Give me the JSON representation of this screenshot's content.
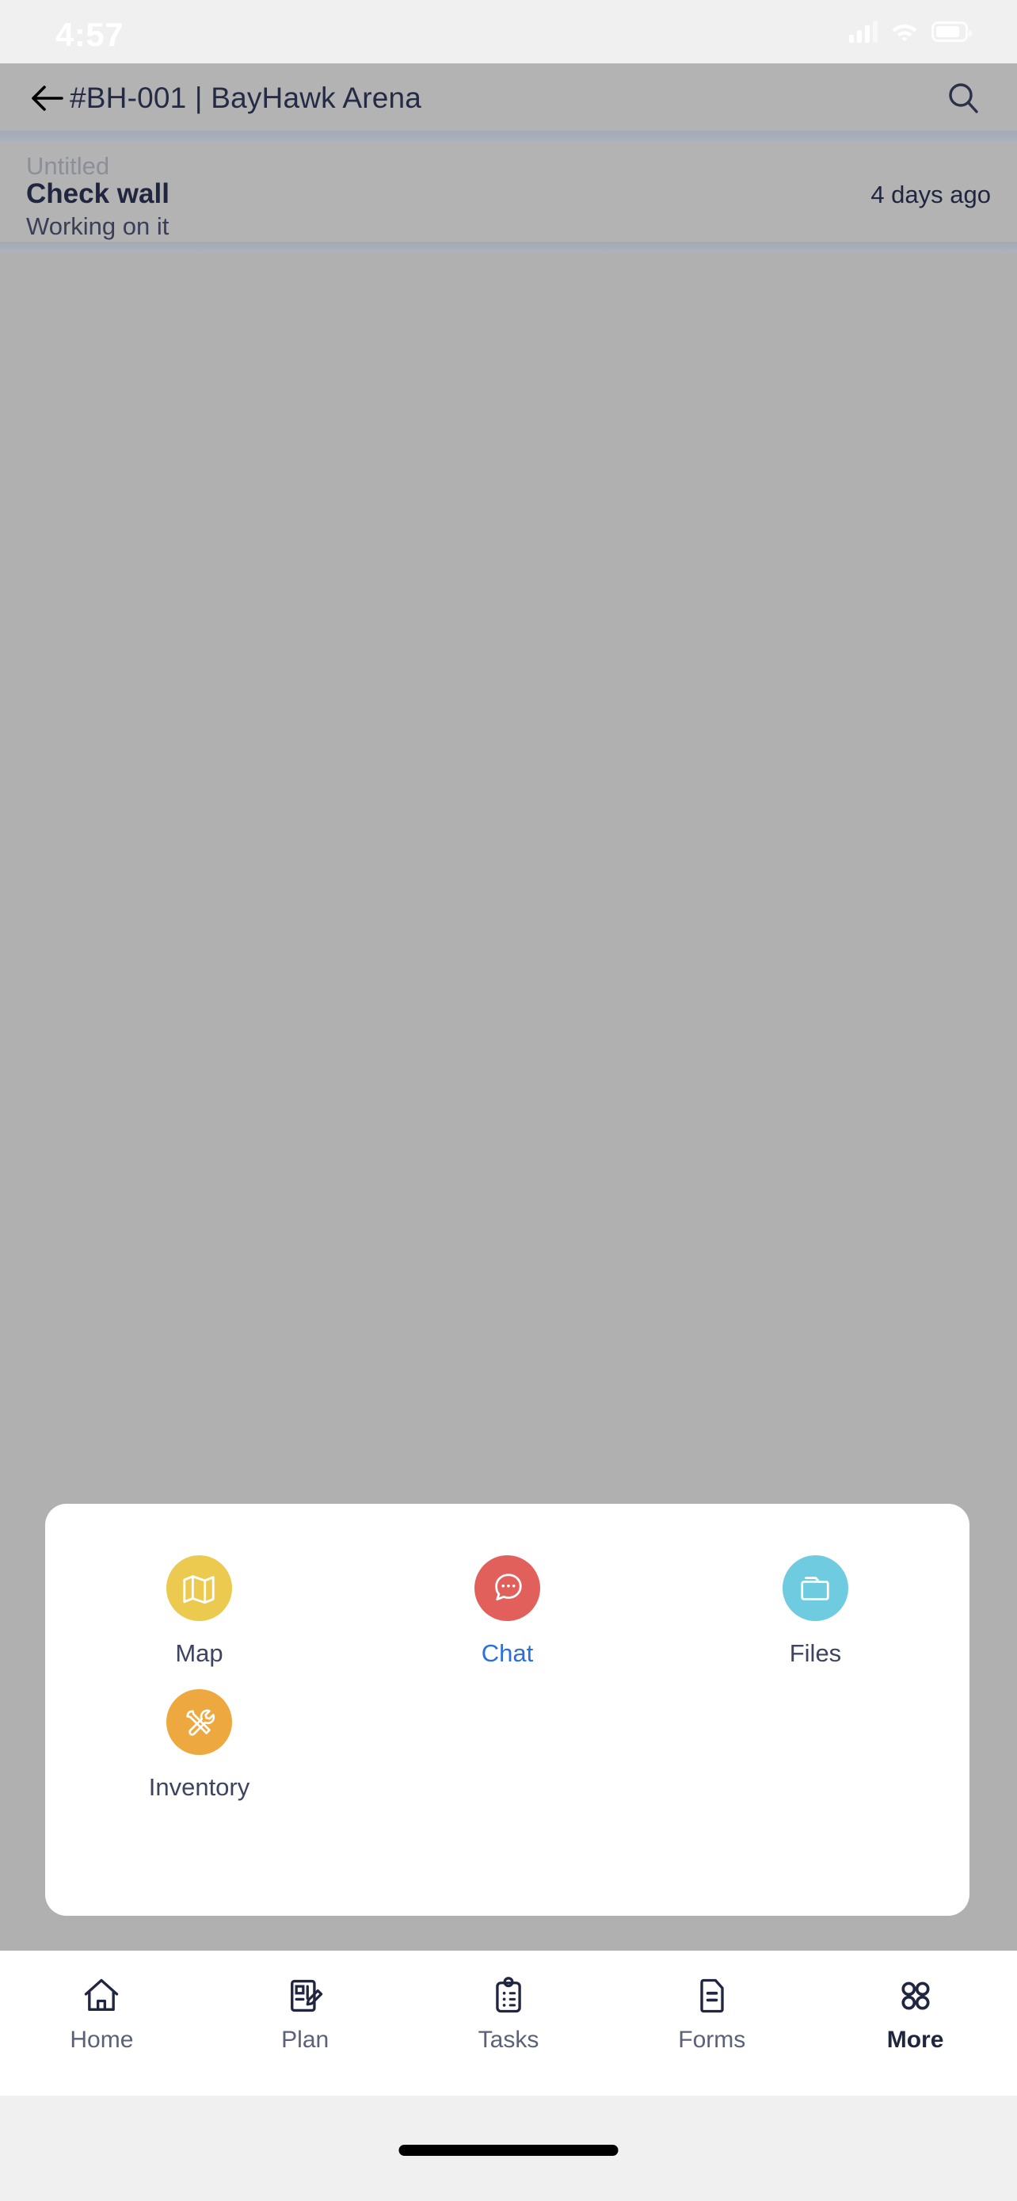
{
  "status_bar": {
    "time": "4:57",
    "cellular_icon": "signal-bars-icon",
    "wifi_icon": "wifi-icon",
    "battery_icon": "battery-icon"
  },
  "header": {
    "back_icon": "back-arrow-icon",
    "title": "#BH-001 | BayHawk Arena",
    "search_icon": "search-icon"
  },
  "task_card": {
    "subtitle": "Untitled",
    "title": "Check wall",
    "status": "Working on it",
    "timestamp": "4 days ago"
  },
  "more_sheet": {
    "items": [
      {
        "label": "Map",
        "icon": "map-icon",
        "color": "#ecc94f",
        "active": false
      },
      {
        "label": "Chat",
        "icon": "chat-icon",
        "color": "#e2605c",
        "active": true
      },
      {
        "label": "Files",
        "icon": "folder-icon",
        "color": "#6fcbe0",
        "active": false
      },
      {
        "label": "Inventory",
        "icon": "tools-icon",
        "color": "#eda83f",
        "active": false
      }
    ],
    "active_color": "#2c6ee0",
    "label_color": "#3e4460"
  },
  "tab_bar": {
    "tabs": [
      {
        "label": "Home",
        "icon": "home-icon",
        "active": false
      },
      {
        "label": "Plan",
        "icon": "plan-edit-icon",
        "active": false
      },
      {
        "label": "Tasks",
        "icon": "clipboard-icon",
        "active": false
      },
      {
        "label": "Forms",
        "icon": "document-icon",
        "active": false
      },
      {
        "label": "More",
        "icon": "grid-icon",
        "active": true
      }
    ],
    "active_color": "#20263f",
    "inactive_color": "#5b6178"
  },
  "home_indicator": {
    "name": "home-indicator"
  }
}
